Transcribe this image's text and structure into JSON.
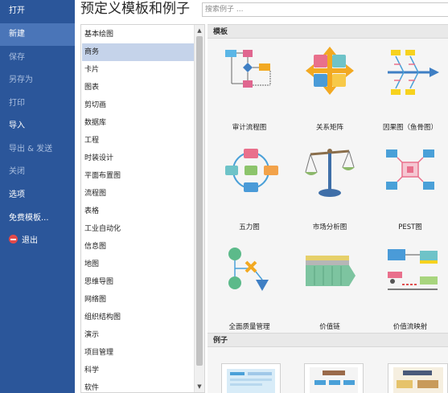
{
  "nav": {
    "items": [
      {
        "label": "打开",
        "state": "normal"
      },
      {
        "label": "新建",
        "state": "active"
      },
      {
        "label": "保存",
        "state": "dim"
      },
      {
        "label": "另存为",
        "state": "dim"
      },
      {
        "label": "打印",
        "state": "dim"
      },
      {
        "label": "导入",
        "state": "normal"
      },
      {
        "label": "导出 & 发送",
        "state": "dim"
      },
      {
        "label": "关闭",
        "state": "dim"
      },
      {
        "label": "选项",
        "state": "normal"
      },
      {
        "label": "免费模板...",
        "state": "normal"
      },
      {
        "label": "退出",
        "state": "normal",
        "icon": "exit-icon"
      }
    ]
  },
  "header": {
    "title": "预定义模板和例子",
    "search_placeholder": "搜索例子 ..."
  },
  "categories": {
    "selected": "商务",
    "items": [
      "基本绘图",
      "商务",
      "卡片",
      "图表",
      "剪切画",
      "数据库",
      "工程",
      "时装设计",
      "平面布置图",
      "流程图",
      "表格",
      "工业自动化",
      "信息图",
      "地图",
      "思维导图",
      "网络图",
      "组织结构图",
      "演示",
      "项目管理",
      "科学",
      "软件"
    ]
  },
  "templates": {
    "section_label": "模板",
    "items": [
      {
        "label": "审计流程图",
        "icon": "audit-flowchart-icon"
      },
      {
        "label": "关系矩阵",
        "icon": "relationship-matrix-icon"
      },
      {
        "label": "因果图（鱼骨图）",
        "icon": "fishbone-diagram-icon"
      },
      {
        "label": "五力图",
        "icon": "five-forces-icon"
      },
      {
        "label": "市场分析图",
        "icon": "balance-scale-icon"
      },
      {
        "label": "PEST图",
        "icon": "pest-diagram-icon"
      },
      {
        "label": "全面质量管理",
        "icon": "tqm-diagram-icon"
      },
      {
        "label": "价值链",
        "icon": "value-chain-icon"
      },
      {
        "label": "价值流映射",
        "icon": "value-stream-map-icon"
      }
    ]
  },
  "examples": {
    "section_label": "例子"
  },
  "colors": {
    "nav_bg": "#2b569a",
    "nav_active": "#4a75b8",
    "category_selected": "#c5d3ea"
  }
}
